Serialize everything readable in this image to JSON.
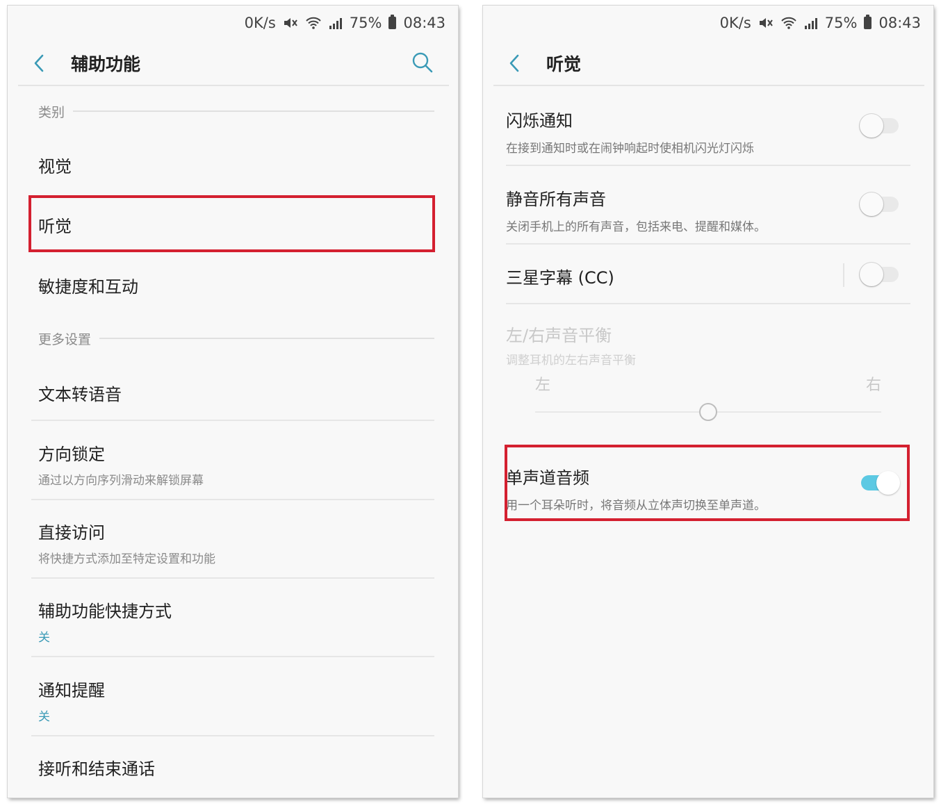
{
  "status_bar": {
    "speed": "0K/s",
    "battery": "75%",
    "time": "08:43",
    "icons": [
      "mute-icon",
      "wifi-icon",
      "signal-icon",
      "battery-icon"
    ]
  },
  "left": {
    "title": "辅助功能",
    "section_category": "类别",
    "items_top": [
      {
        "title": "视觉"
      },
      {
        "title": "听觉"
      },
      {
        "title": "敏捷度和互动"
      }
    ],
    "section_more": "更多设置",
    "items_more": [
      {
        "title": "文本转语音",
        "subtitle": ""
      },
      {
        "title": "方向锁定",
        "subtitle": "通过以方向序列滑动来解锁屏幕"
      },
      {
        "title": "直接访问",
        "subtitle": "将快捷方式添加至特定设置和功能"
      },
      {
        "title": "辅助功能快捷方式",
        "subtitle": "关"
      },
      {
        "title": "通知提醒",
        "subtitle": "关"
      },
      {
        "title": "接听和结束通话",
        "subtitle": ""
      }
    ]
  },
  "right": {
    "title": "听觉",
    "items": [
      {
        "title": "闪烁通知",
        "subtitle": "在接到通知时或在闹钟响起时使相机闪光灯闪烁",
        "enabled": false
      },
      {
        "title": "静音所有声音",
        "subtitle": "关闭手机上的所有声音，包括来电、提醒和媒体。",
        "enabled": false
      },
      {
        "title": "三星字幕 (CC)",
        "subtitle": "",
        "enabled": false
      },
      {
        "title": "单声道音频",
        "subtitle": "用一个耳朵听时，将音频从立体声切换至单声道。",
        "enabled": true
      }
    ],
    "balance": {
      "title": "左/右声音平衡",
      "subtitle": "调整耳机的左右声音平衡",
      "left_label": "左",
      "right_label": "右",
      "value": 0.5
    }
  },
  "colors": {
    "accent": "#3a9ab6",
    "switch_on": "#5cc9e3",
    "highlight": "#d42030"
  }
}
